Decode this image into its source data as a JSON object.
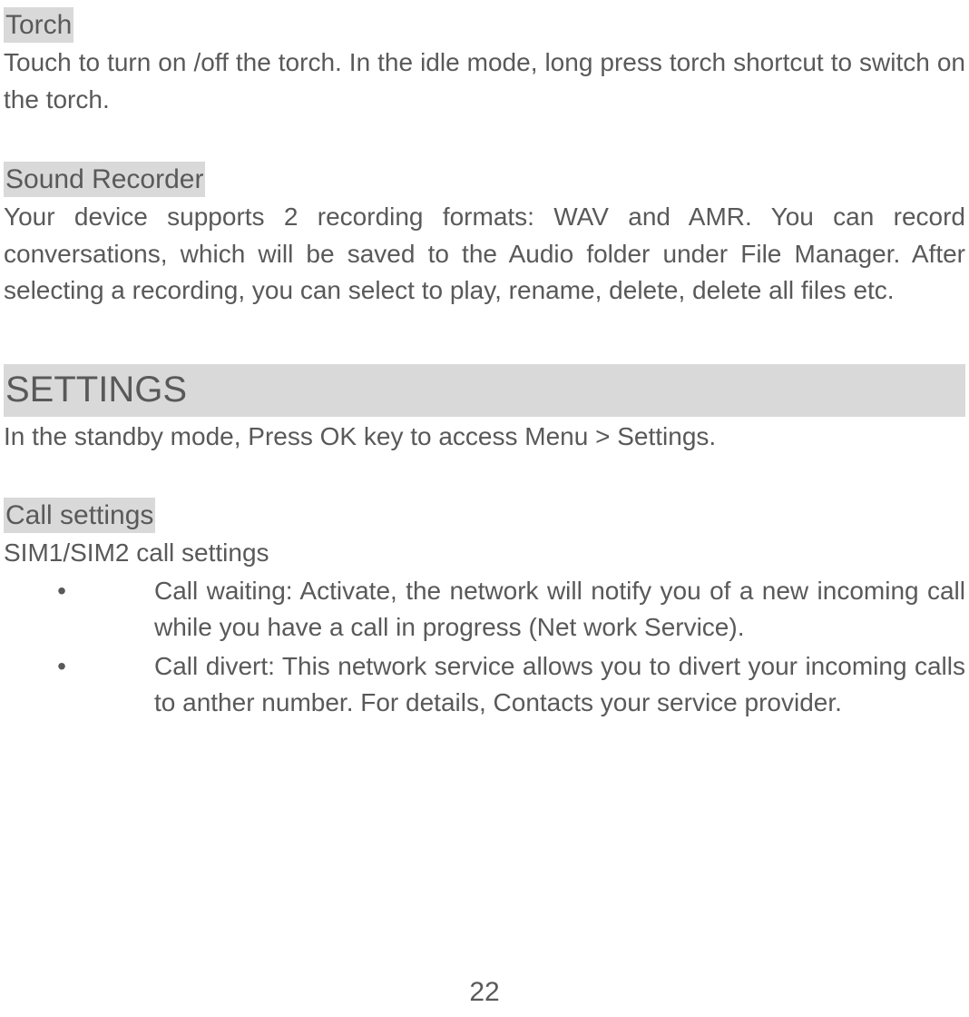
{
  "sections": {
    "torch": {
      "heading": "Torch",
      "body": "Touch to turn on /off the torch. In the idle mode, long press torch shortcut to switch on the torch."
    },
    "sound_recorder": {
      "heading": "Sound Recorder",
      "body": "Your device supports 2 recording formats: WAV and AMR. You can record conversations, which will be saved to the Audio folder under File Manager. After selecting a recording, you can select to play, rename, delete, delete all files etc."
    },
    "settings": {
      "heading": "SETTINGS",
      "intro": "In the standby mode, Press OK key to access Menu > Settings."
    },
    "call_settings": {
      "heading": "Call settings",
      "subheading": "SIM1/SIM2 call settings",
      "bullets": [
        {
          "label": "Call waiting: ",
          "text": "Activate, the network will notify you of a new incoming call while you have a call in progress (Net work Service)."
        },
        {
          "label": "Call divert: ",
          "text": "This network service allows you to divert your incoming calls to anther number. For details, Contacts your service provider."
        }
      ]
    }
  },
  "page_number": "22",
  "bullet_char": "•"
}
